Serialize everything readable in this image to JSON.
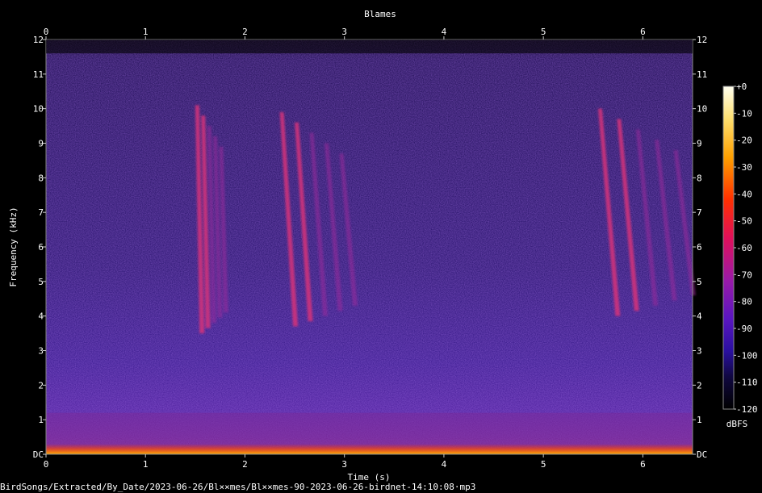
{
  "chart_data": {
    "type": "heatmap",
    "title": "Blames",
    "xlabel": "Time (s)",
    "ylabel": "Frequency (kHz)",
    "xlim": [
      0,
      6.5
    ],
    "ylim": [
      0,
      12
    ],
    "x_ticks": [
      "0",
      "1",
      "2",
      "3",
      "4",
      "5",
      "6"
    ],
    "y_ticks": [
      "DC",
      "1",
      "2",
      "3",
      "4",
      "5",
      "6",
      "7",
      "8",
      "9",
      "10",
      "11",
      "12"
    ],
    "colorbar": {
      "label": "dBFS",
      "range": [
        -120,
        0
      ],
      "ticks": [
        "+0",
        "-10",
        "-20",
        "-30",
        "-40",
        "-50",
        "-60",
        "-70",
        "-80",
        "-90",
        "-100",
        "-110",
        "-120"
      ]
    },
    "colors": {
      "background": "#000000",
      "noise_low": "#1b0a52",
      "noise_mid": "#3a1590",
      "signal": "#d6337a",
      "hot": "#ff7a00"
    },
    "calls": [
      {
        "t_start": 1.5,
        "t_end": 1.8,
        "f_low": 3.5,
        "f_high": 10.1
      },
      {
        "t_start": 2.35,
        "t_end": 3.1,
        "f_low": 3.7,
        "f_high": 9.9
      },
      {
        "t_start": 5.55,
        "t_end": 6.5,
        "f_low": 4.0,
        "f_high": 10.0
      }
    ]
  },
  "footer": {
    "file_path": "BirdSongs/Extracted/By_Date/2023-06-26/Bl××mes/Bl××mes-90-2023-06-26-birdnet-14:10:08·mp3"
  }
}
